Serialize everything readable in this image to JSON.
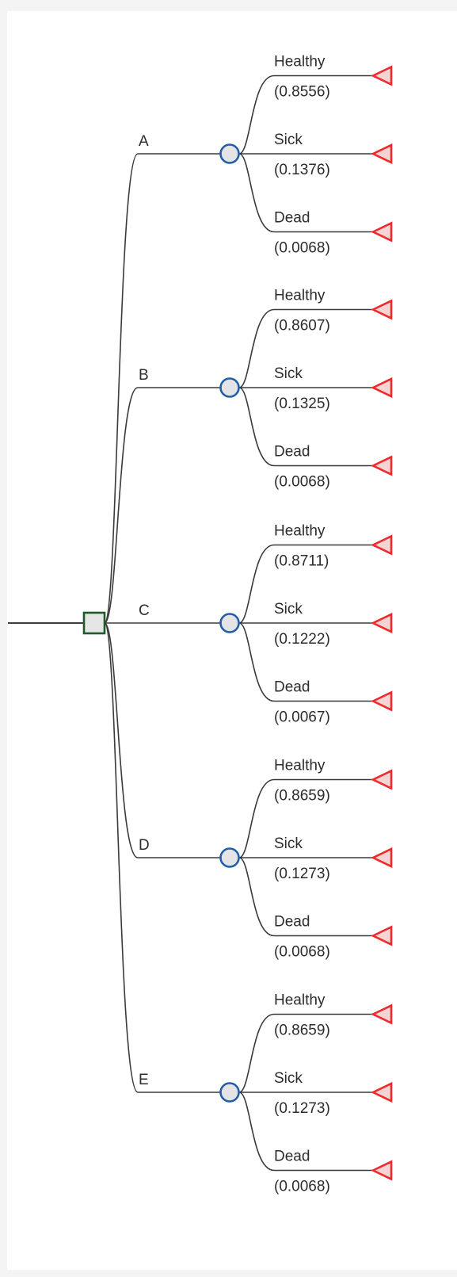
{
  "tree": {
    "decision_node": {
      "icon": "decision-square"
    },
    "options": [
      {
        "label": "A",
        "outcomes": [
          {
            "label": "Healthy",
            "probability": "(0.8556)"
          },
          {
            "label": "Sick",
            "probability": "(0.1376)"
          },
          {
            "label": "Dead",
            "probability": "(0.0068)"
          }
        ]
      },
      {
        "label": "B",
        "outcomes": [
          {
            "label": "Healthy",
            "probability": "(0.8607)"
          },
          {
            "label": "Sick",
            "probability": "(0.1325)"
          },
          {
            "label": "Dead",
            "probability": "(0.0068)"
          }
        ]
      },
      {
        "label": "C",
        "outcomes": [
          {
            "label": "Healthy",
            "probability": "(0.8711)"
          },
          {
            "label": "Sick",
            "probability": "(0.1222)"
          },
          {
            "label": "Dead",
            "probability": "(0.0067)"
          }
        ]
      },
      {
        "label": "D",
        "outcomes": [
          {
            "label": "Healthy",
            "probability": "(0.8659)"
          },
          {
            "label": "Sick",
            "probability": "(0.1273)"
          },
          {
            "label": "Dead",
            "probability": "(0.0068)"
          }
        ]
      },
      {
        "label": "E",
        "outcomes": [
          {
            "label": "Healthy",
            "probability": "(0.8659)"
          },
          {
            "label": "Sick",
            "probability": "(0.1273)"
          },
          {
            "label": "Dead",
            "probability": "(0.0068)"
          }
        ]
      }
    ],
    "colors": {
      "decision_stroke": "#1f5a2a",
      "chance_stroke": "#1e5fa8",
      "terminal_stroke": "#ee2a2a",
      "edge": "#3a3a3a"
    }
  }
}
